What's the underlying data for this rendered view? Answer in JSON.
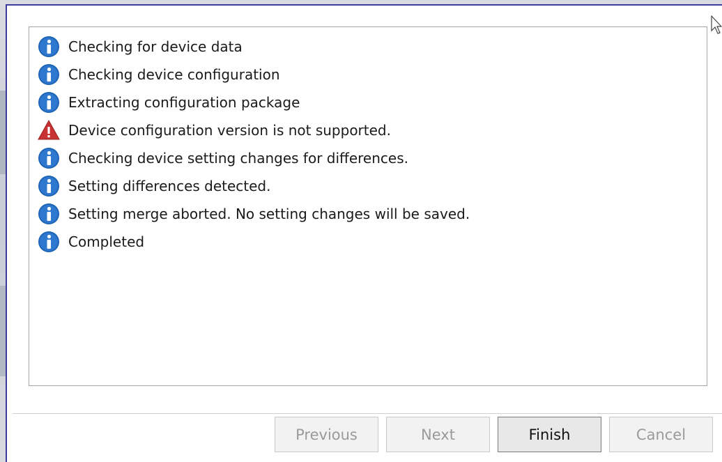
{
  "log": {
    "items": [
      {
        "icon": "info-icon",
        "text": "Checking for device data"
      },
      {
        "icon": "info-icon",
        "text": "Checking device configuration"
      },
      {
        "icon": "info-icon",
        "text": "Extracting configuration package"
      },
      {
        "icon": "warning-icon",
        "text": "Device configuration version is not supported."
      },
      {
        "icon": "info-icon",
        "text": "Checking device setting changes for differences."
      },
      {
        "icon": "info-icon",
        "text": "Setting differences detected."
      },
      {
        "icon": "info-icon",
        "text": "Setting merge aborted.  No setting changes will be saved."
      },
      {
        "icon": "info-icon",
        "text": "Completed"
      }
    ]
  },
  "buttons": {
    "previous": "Previous",
    "next": "Next",
    "finish": "Finish",
    "cancel": "Cancel"
  },
  "colors": {
    "info": "#1f64b7",
    "warning": "#c83232",
    "dialog_border": "#3d3a9e"
  }
}
